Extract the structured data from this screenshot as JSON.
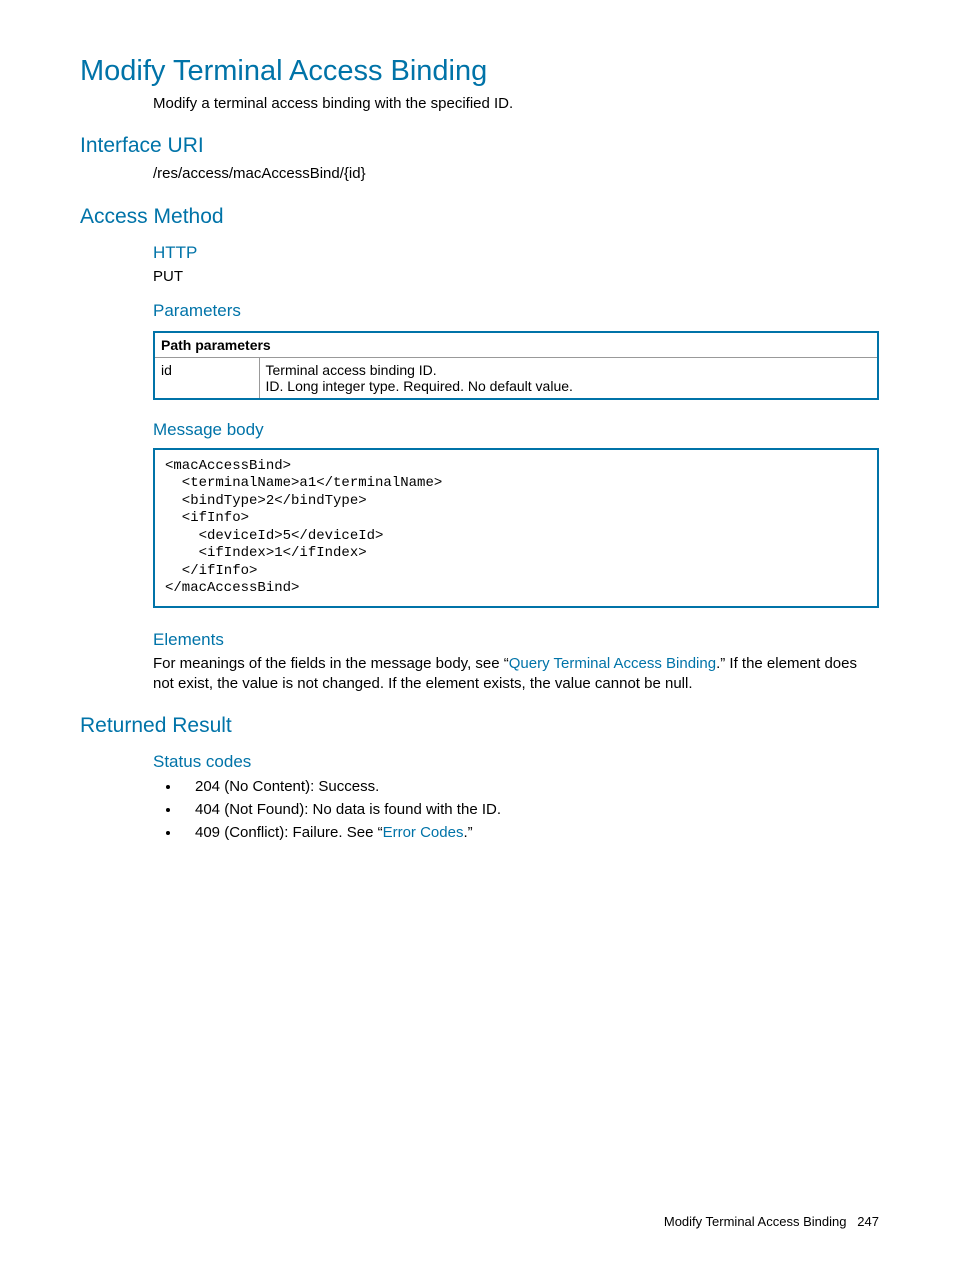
{
  "title": "Modify Terminal Access Binding",
  "intro": "Modify a terminal access binding with the specified ID.",
  "sections": {
    "interface_uri": {
      "heading": "Interface URI",
      "value": "/res/access/macAccessBind/{id}"
    },
    "access_method": {
      "heading": "Access Method",
      "http": {
        "heading": "HTTP",
        "value": "PUT"
      },
      "parameters": {
        "heading": "Parameters",
        "table": {
          "header": "Path parameters",
          "rows": [
            {
              "name": "id",
              "desc1": "Terminal access binding ID.",
              "desc2": "ID. Long integer type. Required. No default value."
            }
          ]
        }
      },
      "message_body": {
        "heading": "Message body",
        "code": "<macAccessBind>\n  <terminalName>a1</terminalName>\n  <bindType>2</bindType>\n  <ifInfo>\n    <deviceId>5</deviceId>\n    <ifIndex>1</ifIndex>\n  </ifInfo>\n</macAccessBind>"
      },
      "elements": {
        "heading": "Elements",
        "prefix": "For meanings of the fields in the message body, see “",
        "link": "Query Terminal Access Binding",
        "suffix": ".” If the element does not exist, the value is not changed. If the element exists, the value cannot be null."
      }
    },
    "returned_result": {
      "heading": "Returned Result",
      "status_codes": {
        "heading": "Status codes",
        "items": [
          {
            "text": "204 (No Content): Success."
          },
          {
            "text": "404 (Not Found): No data is found with the ID."
          },
          {
            "prefix": "409 (Conflict): Failure. See “",
            "link": "Error Codes",
            "suffix": ".”"
          }
        ]
      }
    }
  },
  "footer": {
    "title": "Modify Terminal Access Binding",
    "page": "247"
  }
}
